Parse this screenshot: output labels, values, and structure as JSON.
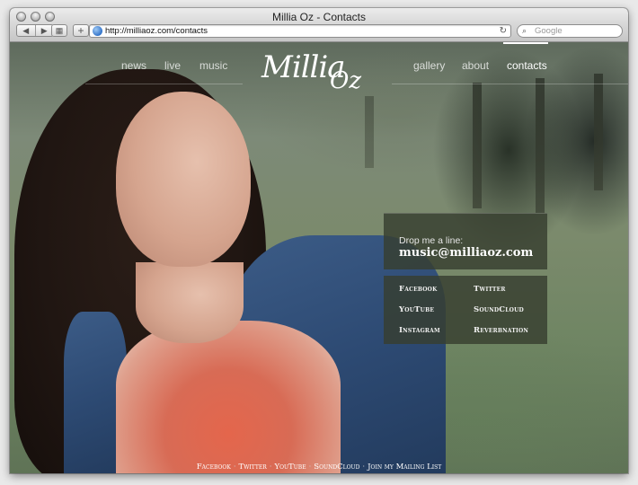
{
  "browser": {
    "window_title": "Millia Oz - Contacts",
    "url": "http://milliaoz.com/contacts",
    "search_placeholder": "Google"
  },
  "site": {
    "logo_main": "Millia",
    "logo_oz": "Oz",
    "nav_left": [
      "news",
      "live",
      "music"
    ],
    "nav_right": [
      "gallery",
      "about",
      "contacts"
    ],
    "active_nav": "contacts"
  },
  "contact": {
    "label": "Drop me a line:",
    "email": "music@milliaoz.com"
  },
  "social": [
    "Facebook",
    "Twitter",
    "YouTube",
    "SoundCloud",
    "Instagram",
    "Reverbnation"
  ],
  "footer": [
    "Facebook",
    "Twitter",
    "YouTube",
    "SoundCloud",
    "Join my Mailing List"
  ]
}
